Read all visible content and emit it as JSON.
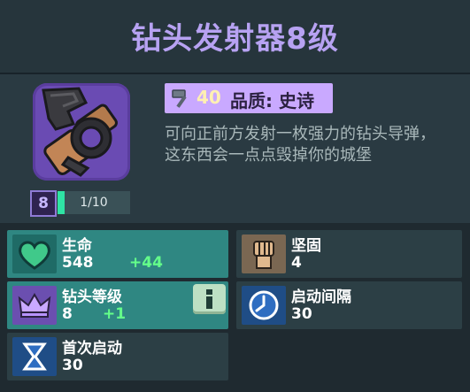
{
  "title": "钻头发射器8级",
  "item": {
    "level": "8",
    "progress_text": "1/10",
    "progress_fraction": 0.1,
    "cost": "40",
    "quality_label": "品质: 史诗",
    "description": "可向正前方发射一枚强力的钻头导弹，这东西会一点点毁掉你的城堡"
  },
  "stats": {
    "health": {
      "label": "生命",
      "value": "548",
      "bonus": "+44",
      "icon": "heart-icon"
    },
    "durability": {
      "label": "坚固",
      "value": "4",
      "icon": "fist-icon"
    },
    "drill_level": {
      "label": "钻头等级",
      "value": "8",
      "bonus": "+1",
      "icon": "crown-icon"
    },
    "interval": {
      "label": "启动间隔",
      "value": "30",
      "icon": "clock-icon"
    },
    "first_start": {
      "label": "首次启动",
      "value": "30",
      "icon": "hourglass-icon"
    }
  },
  "colors": {
    "title": "#b7a2f2",
    "highlight_stat": "#2f8782",
    "bonus_text": "#64ff8a",
    "quality_badge": "#c9a9ff"
  }
}
